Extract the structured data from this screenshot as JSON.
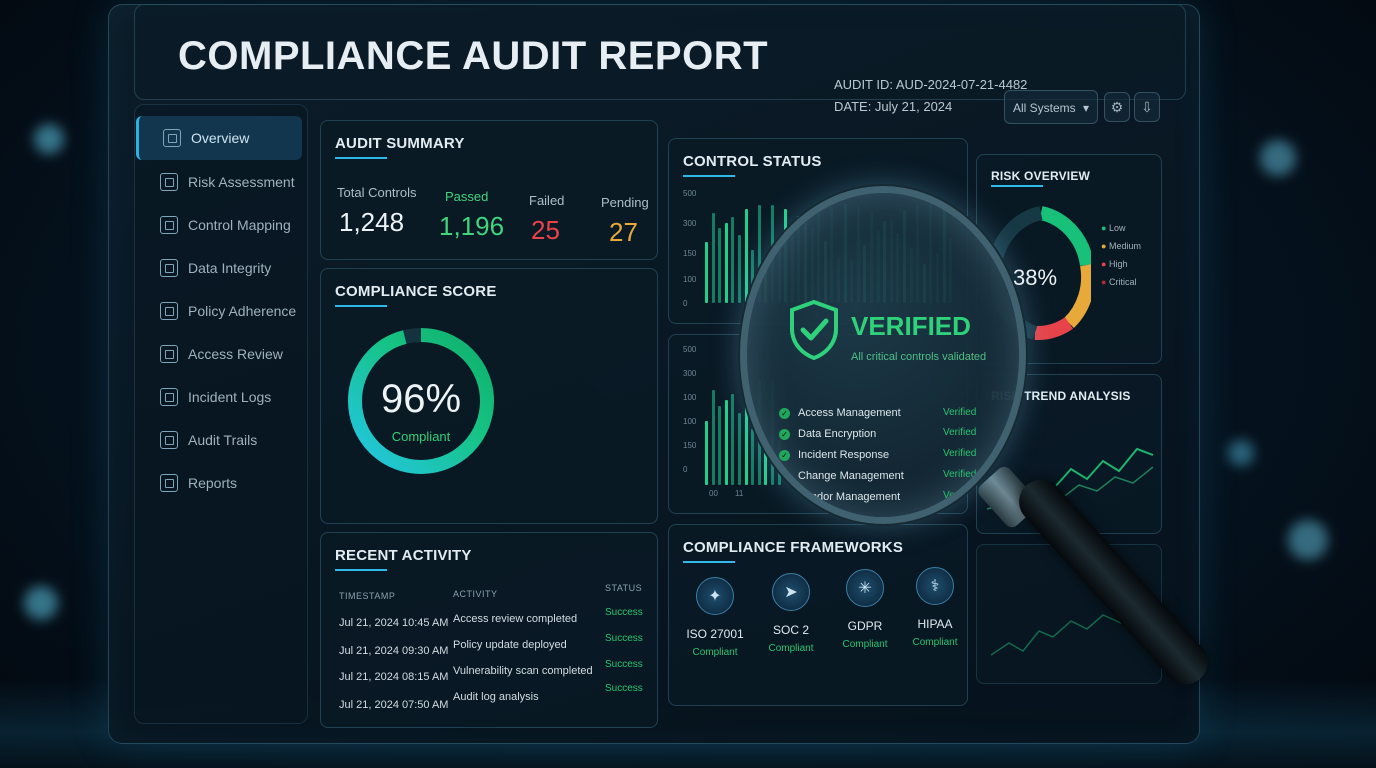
{
  "header": {
    "title": "COMPLIANCE AUDIT REPORT",
    "audit_id": "AUDIT ID: AUD-2024-07-21-4482",
    "date": "DATE: July 21, 2024",
    "system_select": "All Systems"
  },
  "sidebar": {
    "items": [
      {
        "label": "Overview"
      },
      {
        "label": "Risk Assessment"
      },
      {
        "label": "Control Mapping"
      },
      {
        "label": "Data Integrity"
      },
      {
        "label": "Policy Adherence"
      },
      {
        "label": "Access Review"
      },
      {
        "label": "Incident Logs"
      },
      {
        "label": "Audit Trails"
      },
      {
        "label": "Reports"
      }
    ]
  },
  "summary": {
    "title": "AUDIT SUMMARY",
    "total_label": "Total Controls",
    "total_value": "1,248",
    "passed_label": "Passed",
    "passed_value": "1,196",
    "failed_label": "Failed",
    "failed_value": "25",
    "pending_label": "Pending",
    "pending_value": "27"
  },
  "score": {
    "title": "COMPLIANCE SCORE",
    "value": "96%",
    "label": "Compliant",
    "percent": 96
  },
  "control_status": {
    "title": "CONTROL STATUS",
    "ticks_top": [
      "500",
      "300",
      "150",
      "100",
      "0"
    ],
    "ticks_bottom": [
      "500",
      "300",
      "100",
      "100",
      "150",
      "0"
    ],
    "xaxis_bottom": [
      "00",
      "11"
    ]
  },
  "verified_card": {
    "title": "VERIFIED",
    "subtitle": "All critical controls validated",
    "rows": [
      {
        "name": "Access Management",
        "status": "Verified"
      },
      {
        "name": "Data Encryption",
        "status": "Verified"
      },
      {
        "name": "Incident Response",
        "status": "Verified"
      },
      {
        "name": "Change Management",
        "status": "Verified"
      },
      {
        "name": "Vendor Management",
        "status": "Verified"
      }
    ]
  },
  "risk": {
    "title": "RISK OVERVIEW",
    "center": "38%",
    "legend": [
      "Low",
      "Medium",
      "High",
      "Critical"
    ]
  },
  "trend": {
    "title": "RISK TREND ANALYSIS"
  },
  "activity": {
    "title": "RECENT ACTIVITY",
    "headers": {
      "timestamp": "TIMESTAMP",
      "activity": "ACTIVITY",
      "status": "STATUS"
    },
    "rows": [
      {
        "time": "Jul 21, 2024 10:45 AM",
        "activity": "Access review completed",
        "status": "Success"
      },
      {
        "time": "Jul 21, 2024 09:30 AM",
        "activity": "Policy update deployed",
        "status": "Success"
      },
      {
        "time": "Jul 21, 2024 08:15 AM",
        "activity": "Vulnerability scan completed",
        "status": "Success"
      },
      {
        "time": "Jul 21, 2024 07:50 AM",
        "activity": "Audit log analysis",
        "status": "Success"
      }
    ]
  },
  "frameworks": {
    "title": "COMPLIANCE FRAMEWORKS",
    "items": [
      {
        "name": "ISO 27001",
        "status": "Compliant"
      },
      {
        "name": "SOC 2",
        "status": "Compliant"
      },
      {
        "name": "GDPR",
        "status": "Compliant"
      },
      {
        "name": "HIPAA",
        "status": "Compliant"
      }
    ]
  },
  "colors": {
    "accent": "#2fb8e8",
    "passed": "#3fd47e",
    "failed": "#e8434a",
    "pending": "#e7a93a"
  }
}
